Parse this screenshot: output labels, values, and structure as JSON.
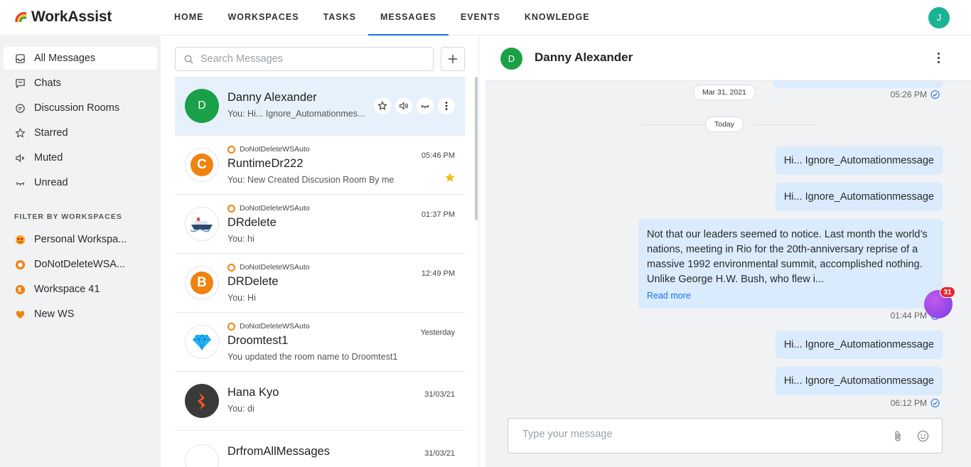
{
  "app": {
    "name": "WorkAssist",
    "user_initial": "J"
  },
  "nav": {
    "items": [
      "HOME",
      "WORKSPACES",
      "TASKS",
      "MESSAGES",
      "EVENTS",
      "KNOWLEDGE"
    ],
    "active": "MESSAGES"
  },
  "sidebar": {
    "items": [
      {
        "label": "All Messages",
        "icon": "inbox-icon",
        "active": true
      },
      {
        "label": "Chats",
        "icon": "chat-icon"
      },
      {
        "label": "Discussion Rooms",
        "icon": "discussion-icon"
      },
      {
        "label": "Starred",
        "icon": "star-icon"
      },
      {
        "label": "Muted",
        "icon": "mute-icon"
      },
      {
        "label": "Unread",
        "icon": "unread-icon"
      }
    ],
    "filter_heading": "FILTER BY WORKSPACES",
    "workspaces": [
      {
        "label": "Personal Workspa...",
        "icon": "emoji-icon"
      },
      {
        "label": "DoNotDeleteWSA...",
        "icon": "workspace-ring-icon"
      },
      {
        "label": "Workspace 41",
        "icon": "workspace-k-icon"
      },
      {
        "label": "New WS",
        "icon": "heart-icon"
      }
    ]
  },
  "list": {
    "search_placeholder": "Search Messages",
    "conversations": [
      {
        "name": "Danny Alexander",
        "preview": "You: Hi... Ignore_Automationmes...",
        "avatar_letter": "D",
        "active": true
      },
      {
        "workspace": "DoNotDeleteWSAuto",
        "name": "RuntimeDr222",
        "preview": "You: New Created Discusion Room By me",
        "time": "05:46 PM",
        "starred": true,
        "avatar_letter": "C"
      },
      {
        "workspace": "DoNotDeleteWSAuto",
        "name": "DRdelete",
        "preview": "You: hi",
        "time": "01:37 PM"
      },
      {
        "workspace": "DoNotDeleteWSAuto",
        "name": "DRDelete",
        "preview": "You: Hi",
        "time": "12:49 PM",
        "avatar_letter": "B"
      },
      {
        "workspace": "DoNotDeleteWSAuto",
        "name": "Droomtest1",
        "preview": "You updated the room name to Droomtest1",
        "time": "Yesterday"
      },
      {
        "name": "Hana Kyo",
        "preview": "You: di",
        "time": "31/03/21"
      },
      {
        "name": "DrfromAllMessages",
        "time": "31/03/21"
      }
    ]
  },
  "chat": {
    "contact_name": "Danny Alexander",
    "contact_initial": "D",
    "date_old": "Mar 31, 2021",
    "time_top": "05:26 PM",
    "date_today": "Today",
    "messages": [
      {
        "text": "Hi... Ignore_Automationmessage"
      },
      {
        "text": "Hi... Ignore_Automationmessage"
      },
      {
        "text": "Not that our leaders seemed to notice. Last month the world’s nations, meeting in Rio for the 20th-anniversary reprise of a massive 1992 environmental summit, accomplished nothing. Unlike George H.W. Bush, who flew i...",
        "read_more": "Read more",
        "time": "01:44 PM"
      },
      {
        "text": "Hi... Ignore_Automationmessage"
      },
      {
        "text": "Hi... Ignore_Automationmessage",
        "time": "06:12 PM"
      }
    ],
    "composer_placeholder": "Type your message",
    "notification_count": "31"
  },
  "colors": {
    "accent": "#1a73e8",
    "bubble": "#d9ebfc",
    "avatar_green": "#1aa046",
    "workspace_orange": "#f0820f"
  }
}
